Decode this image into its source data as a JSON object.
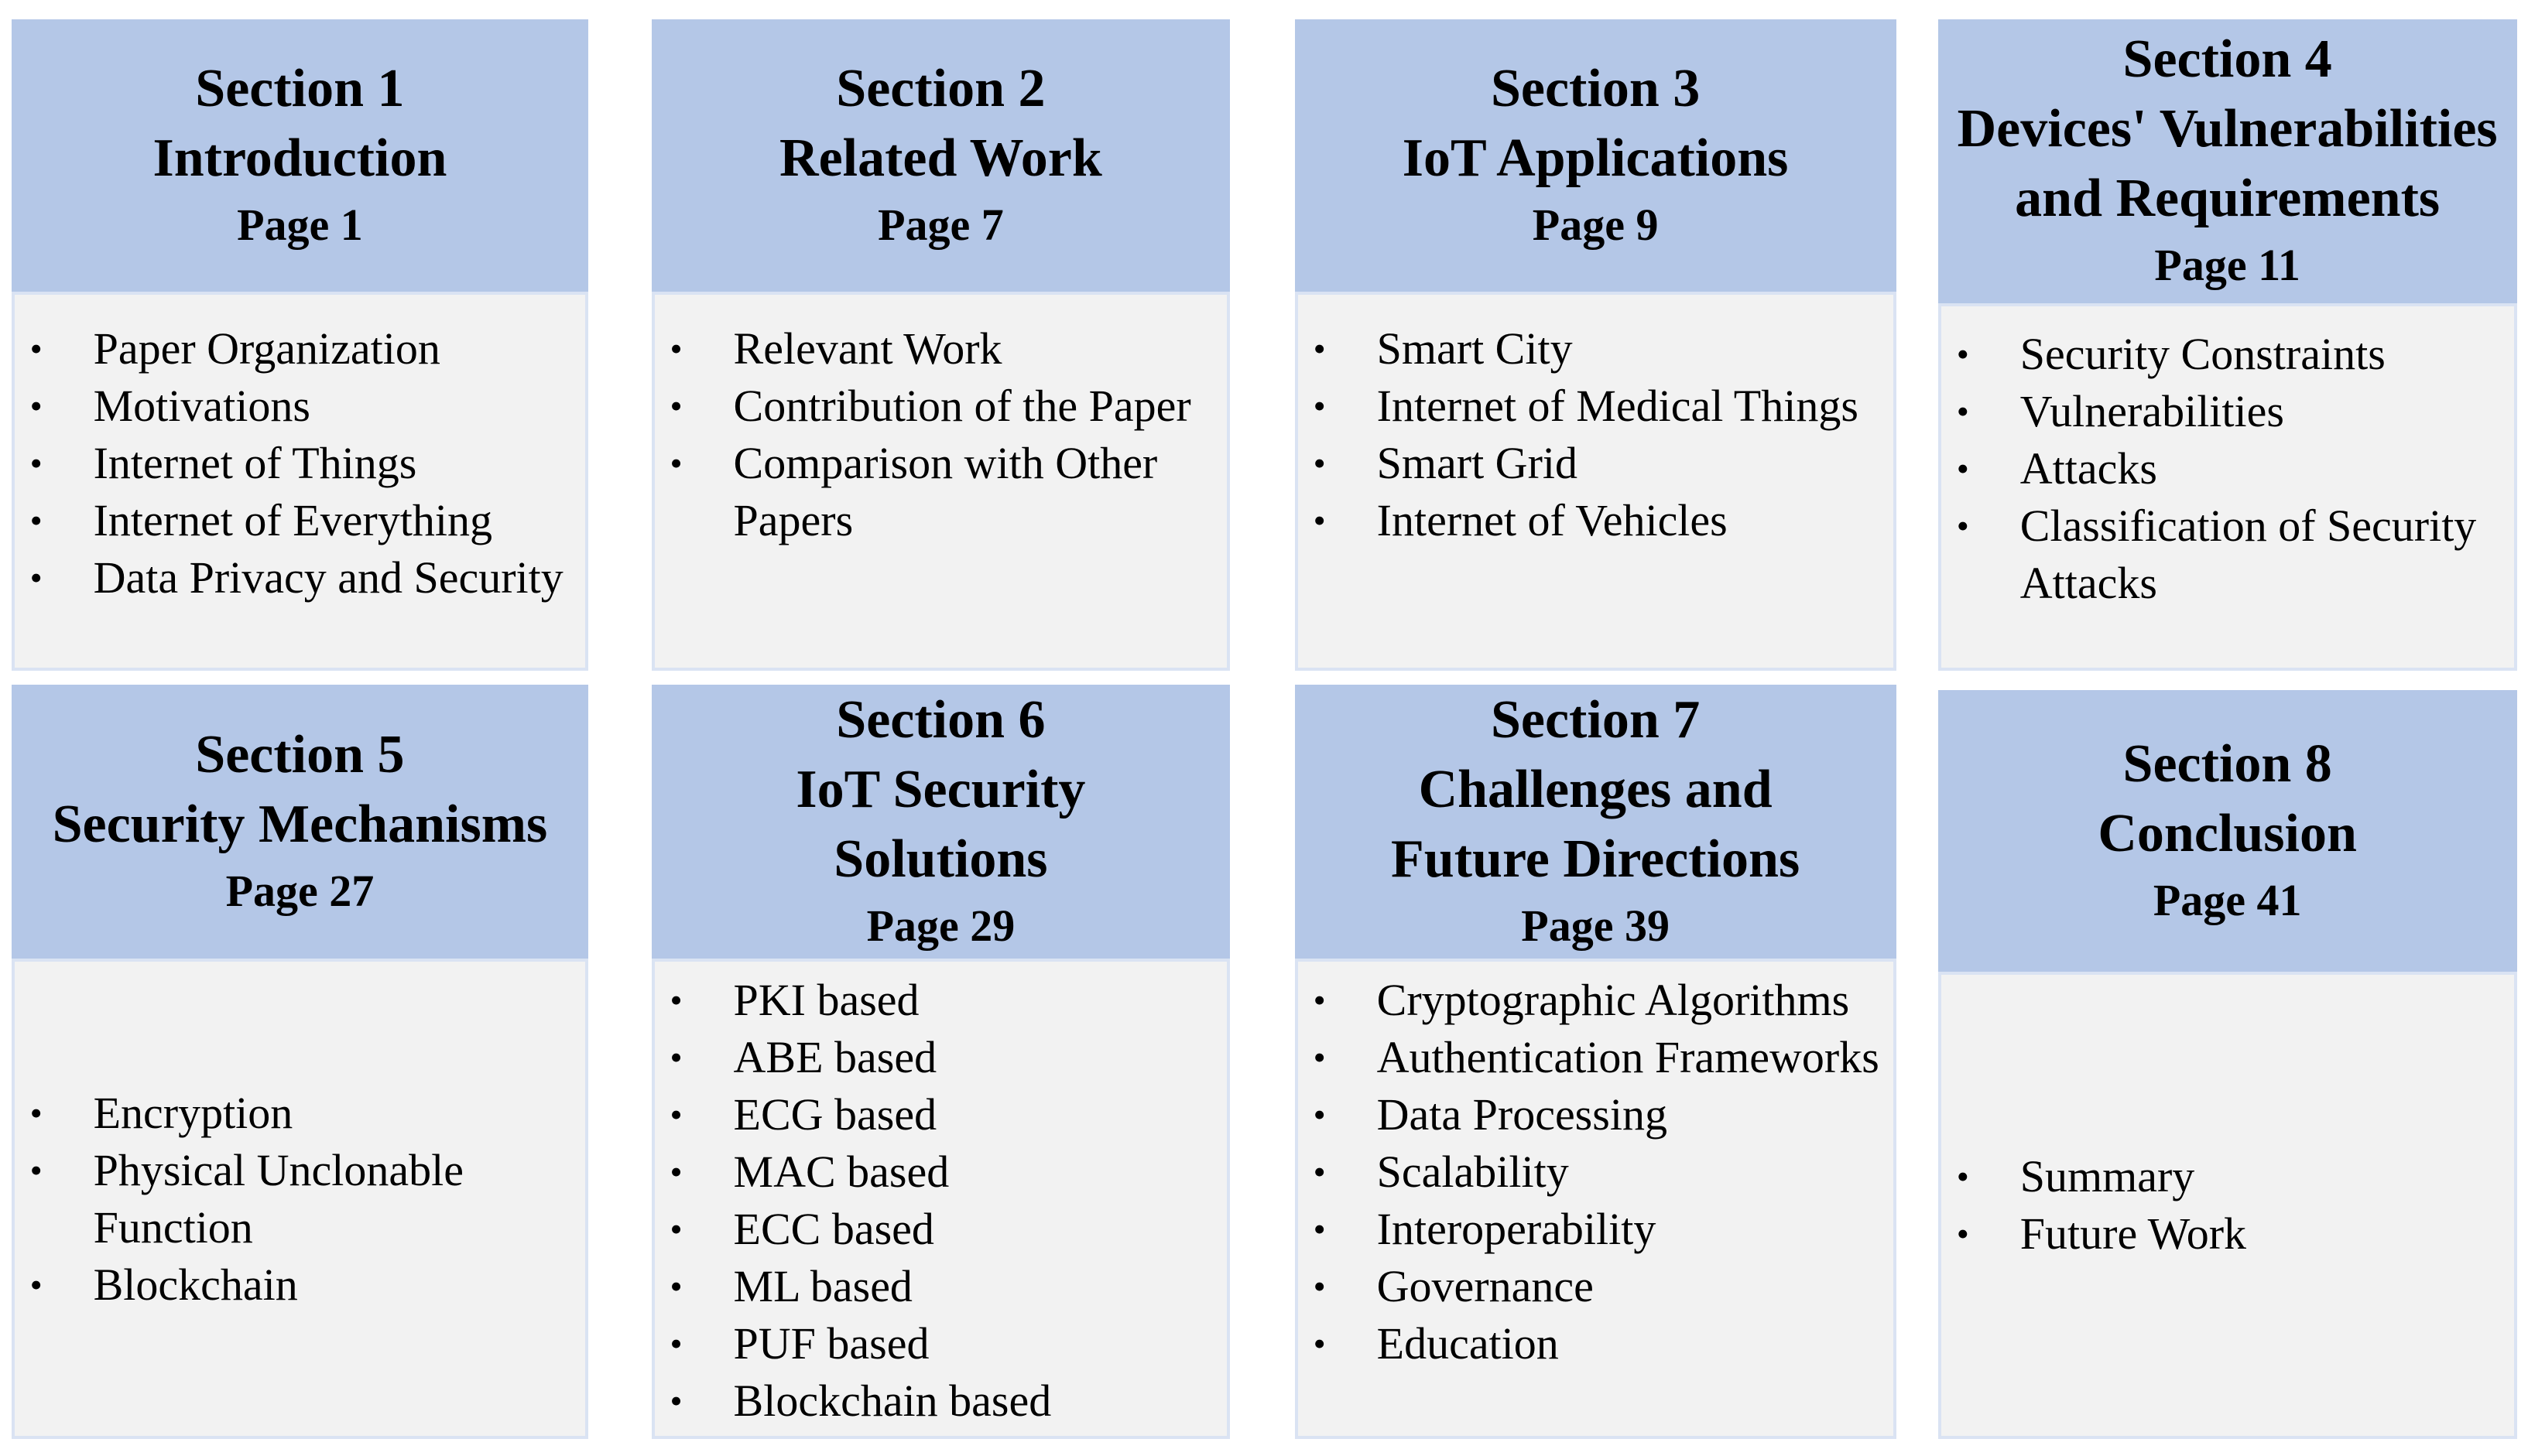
{
  "sections": [
    {
      "title_lines": [
        "Section 1",
        "Introduction"
      ],
      "page": "Page 1",
      "items": [
        "Paper Organization",
        "Motivations",
        "Internet of Things",
        "Internet of Everything",
        "Data Privacy and Security"
      ]
    },
    {
      "title_lines": [
        "Section 2",
        "Related Work"
      ],
      "page": "Page 7",
      "items": [
        "Relevant Work",
        "Contribution of the Paper",
        "Comparison with Other Papers"
      ]
    },
    {
      "title_lines": [
        "Section 3",
        "IoT Applications"
      ],
      "page": "Page 9",
      "items": [
        "Smart City",
        "Internet of Medical Things",
        "Smart Grid",
        "Internet of Vehicles"
      ]
    },
    {
      "title_lines": [
        "Section 4",
        "Devices' Vulnerabilities",
        "and Requirements"
      ],
      "page": "Page 11",
      "items": [
        "Security Constraints",
        "Vulnerabilities",
        "Attacks",
        "Classification of Security Attacks"
      ]
    },
    {
      "title_lines": [
        "Section 5",
        "Security Mechanisms"
      ],
      "page": "Page 27",
      "items": [
        "Encryption",
        "Physical Unclonable Function",
        "Blockchain"
      ]
    },
    {
      "title_lines": [
        "Section 6",
        "IoT Security",
        "Solutions"
      ],
      "page": "Page 29",
      "items": [
        "PKI based",
        "ABE based",
        "ECG based",
        "MAC based",
        "ECC based",
        "ML based",
        "PUF based",
        "Blockchain based"
      ]
    },
    {
      "title_lines": [
        "Section 7",
        "Challenges and",
        "Future Directions"
      ],
      "page": "Page 39",
      "items": [
        "Cryptographic Algorithms",
        "Authentication Frameworks",
        "Data Processing",
        "Scalability",
        "Interoperability",
        "Governance",
        "Education"
      ]
    },
    {
      "title_lines": [
        "Section 8",
        "Conclusion"
      ],
      "page": "Page 41",
      "items": [
        "Summary",
        "Future Work"
      ]
    }
  ],
  "colors": {
    "header_bg": "#b4c7e7",
    "body_bg": "#f2f2f2",
    "body_border": "#dae3f3"
  }
}
